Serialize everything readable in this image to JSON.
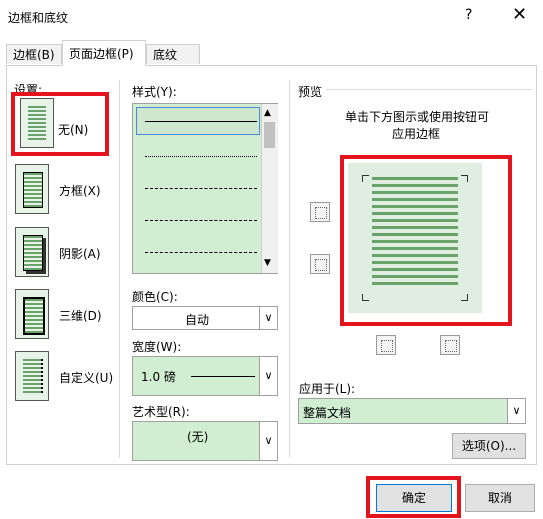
{
  "dialog": {
    "title": "边框和底纹",
    "help": "?",
    "close": "✕"
  },
  "tabs": [
    {
      "label": "边框(B)"
    },
    {
      "label": "页面边框(P)"
    },
    {
      "label": "底纹(S)"
    }
  ],
  "settings": {
    "heading": "设置:",
    "options": [
      {
        "label": "无(N)",
        "selected": true
      },
      {
        "label": "方框(X)"
      },
      {
        "label": "阴影(A)"
      },
      {
        "label": "三维(D)"
      },
      {
        "label": "自定义(U)"
      }
    ]
  },
  "style": {
    "heading": "样式(Y):"
  },
  "color": {
    "heading": "颜色(C):",
    "value": "自动"
  },
  "width": {
    "heading": "宽度(W):",
    "value": "1.0 磅"
  },
  "art": {
    "heading": "艺术型(R):",
    "value": "(无)"
  },
  "preview": {
    "heading": "预览",
    "hint_line1": "单击下方图示或使用按钮可",
    "hint_line2": "应用边框"
  },
  "apply_to": {
    "heading": "应用于(L):",
    "value": "整篇文档"
  },
  "buttons": {
    "options": "选项(O)...",
    "ok": "确定",
    "cancel": "取消"
  },
  "colors": {
    "highlight": "#e3141c",
    "list_bg": "#d1eed2",
    "line_green": "#6aa36a"
  }
}
